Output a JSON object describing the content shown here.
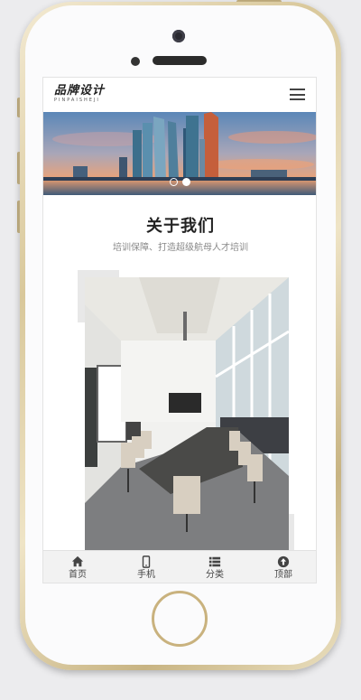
{
  "header": {
    "logo_title": "品牌设计",
    "logo_subtitle": "PINPAISHEJI"
  },
  "banner": {
    "slide_count": 2,
    "active_slide": 2
  },
  "about": {
    "title": "关于我们",
    "subtitle": "培训保障、打造超级航母人才培训"
  },
  "bottom_nav": [
    {
      "label": "首页",
      "icon": "home-icon"
    },
    {
      "label": "手机",
      "icon": "mobile-icon"
    },
    {
      "label": "分类",
      "icon": "list-icon"
    },
    {
      "label": "顶部",
      "icon": "arrow-up-icon"
    }
  ],
  "colors": {
    "gold": "#c9b27e",
    "text": "#222222",
    "muted": "#888888",
    "nav_bg": "#f2f2f2"
  }
}
